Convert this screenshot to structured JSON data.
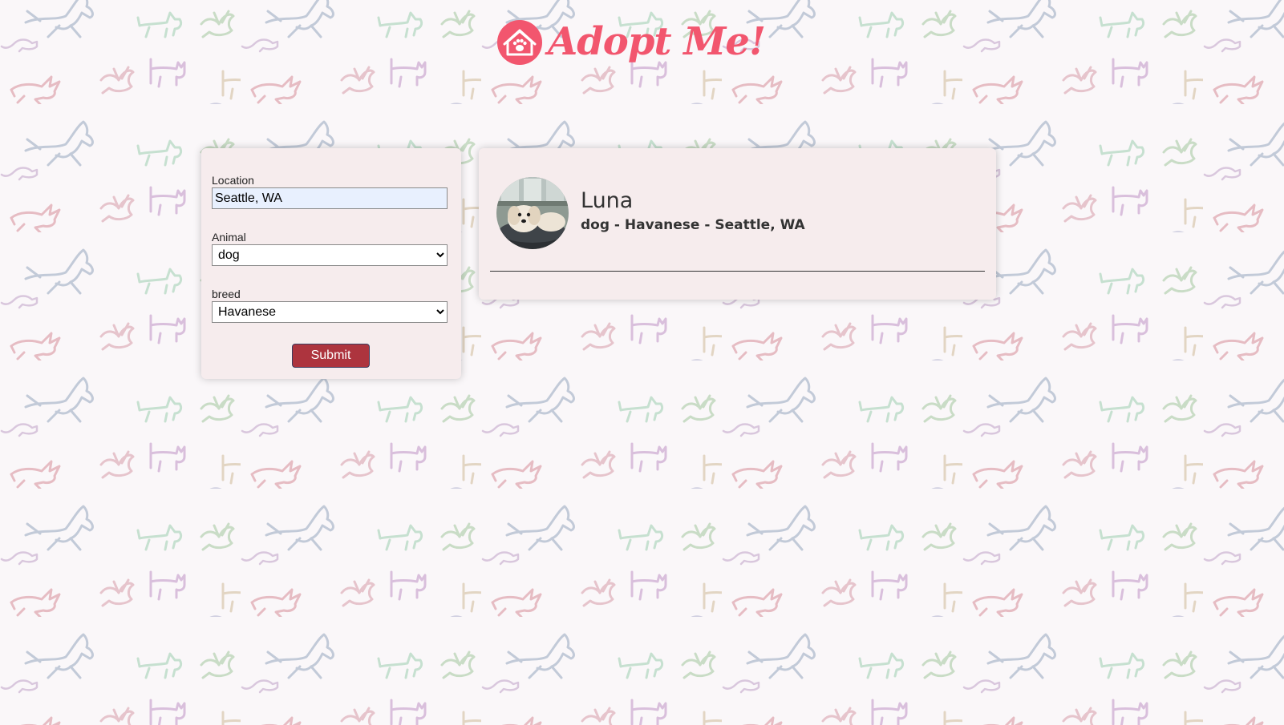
{
  "header": {
    "logo_text": "Adopt Me!",
    "brand_color": "#f2566e"
  },
  "search_form": {
    "location_label": "Location",
    "location_value": "Seattle, WA",
    "animal_label": "Animal",
    "animal_selected": "dog",
    "breed_label": "breed",
    "breed_selected": "Havanese",
    "submit_label": "Submit",
    "submit_color": "#ad343e"
  },
  "results": [
    {
      "name": "Luna",
      "info": "dog - Havanese - Seattle, WA",
      "photo": "havanese-dog-photo"
    }
  ],
  "background": {
    "pattern": "outlined-animal-doodles",
    "colors": [
      "#c7ced9",
      "#e8c0c6",
      "#d8c1da",
      "#c8dfcf",
      "#e3d7c4"
    ]
  }
}
